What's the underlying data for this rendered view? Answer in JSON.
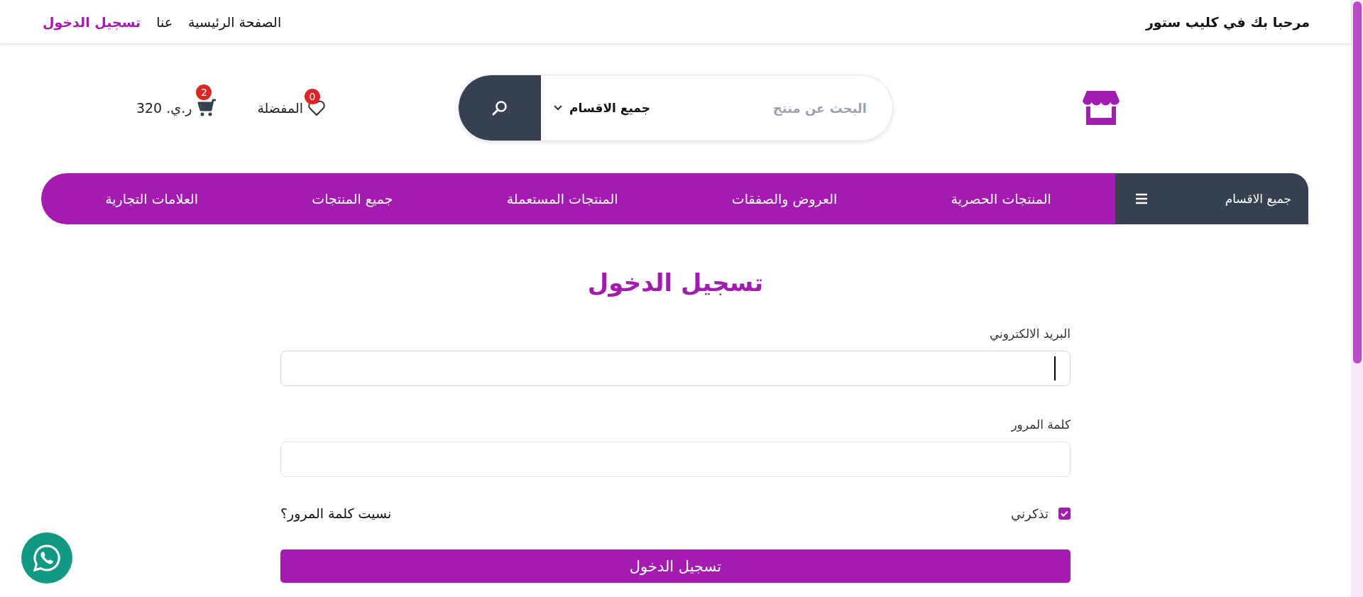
{
  "top_bar": {
    "welcome": "مرحبا بك في كليب ستور",
    "links": [
      {
        "label": "الصفحة الرئيسية",
        "selected": false
      },
      {
        "label": "عنا",
        "selected": false
      },
      {
        "label": "تسجيل الدخول",
        "selected": true
      }
    ]
  },
  "header": {
    "search": {
      "placeholder": "البحث عن منتج",
      "category": "جميع الاقسام"
    },
    "wishlist": {
      "label": "المفضلة",
      "count": "0"
    },
    "cart": {
      "count": "2",
      "total": "ر.ي. 320"
    }
  },
  "nav": {
    "categories_button": "جميع الاقسام",
    "items": [
      "المنتجات الحصرية",
      "العروض والصفقات",
      "المنتجات المستعملة",
      "جميع المنتجات",
      "العلامات التجارية"
    ]
  },
  "login_form": {
    "title": "تسجيل الدخول",
    "fields": [
      {
        "label": "البريد الالكتروني",
        "focused": true
      },
      {
        "label": "كلمة المرور",
        "focused": false
      }
    ],
    "remember": {
      "label": "تذكرني",
      "checked": true
    },
    "forgot_link": "نسيت كلمة المرور؟",
    "submit": "تسجيل الدخول"
  }
}
